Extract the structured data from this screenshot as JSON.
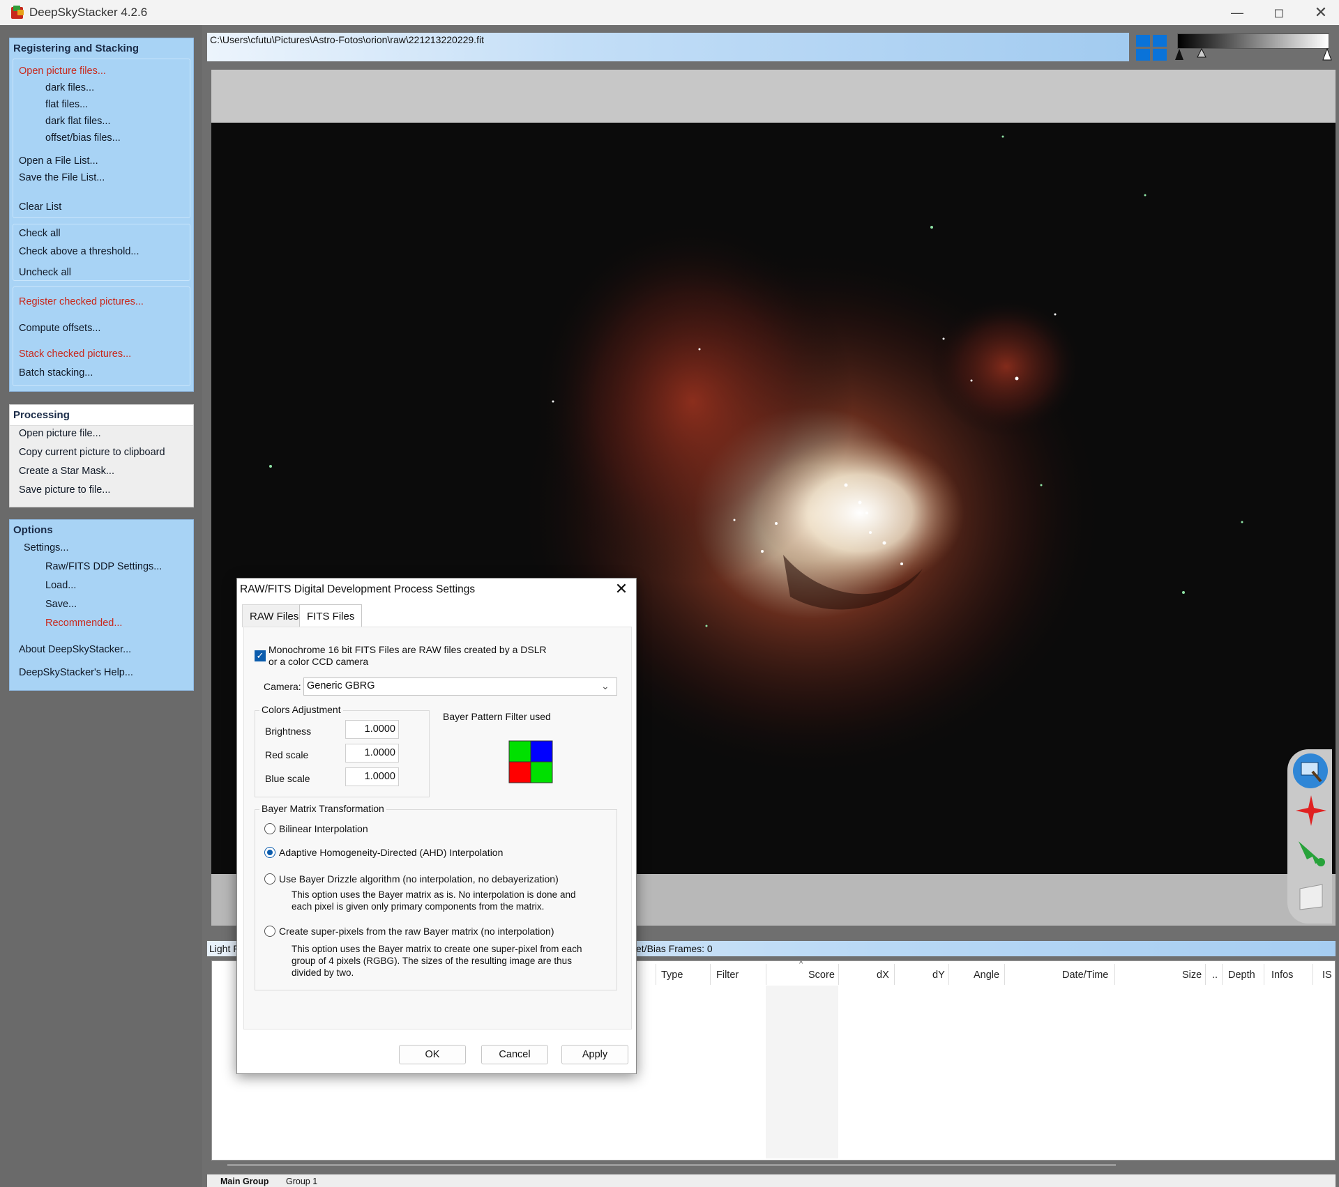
{
  "window": {
    "title": "DeepSkyStacker 4.2.6",
    "controls": [
      "minimize-icon",
      "maximize-icon",
      "close-icon"
    ]
  },
  "sidebar": {
    "registering": {
      "header": "Registering and Stacking",
      "open_picture_files": "Open picture files...",
      "dark_files": "dark files...",
      "flat_files": "flat files...",
      "dark_flat_files": "dark flat files...",
      "offset_bias_files": "offset/bias files...",
      "open_file_list": "Open a File List...",
      "save_file_list": "Save the File List...",
      "clear_list": "Clear List",
      "check_all": "Check all",
      "check_above_threshold": "Check above a threshold...",
      "uncheck_all": "Uncheck all",
      "register_checked": "Register checked pictures...",
      "compute_offsets": "Compute offsets...",
      "stack_checked": "Stack checked pictures...",
      "batch_stacking": "Batch stacking..."
    },
    "processing": {
      "header": "Processing",
      "open_picture_file": "Open picture file...",
      "copy_to_clipboard": "Copy current picture to clipboard",
      "create_star_mask": "Create a Star Mask...",
      "save_picture": "Save picture to file..."
    },
    "options": {
      "header": "Options",
      "settings": "Settings...",
      "raw_fits_ddp": "Raw/FITS DDP Settings...",
      "load": "Load...",
      "save": "Save...",
      "recommended": "Recommended...",
      "about": "About DeepSkyStacker...",
      "help": "DeepSkyStacker's Help..."
    }
  },
  "viewer": {
    "file_path": "C:\\Users\\cfutu\\Pictures\\Astro-Fotos\\orion\\raw\\221213220229.fit",
    "tools": [
      "select-rectangle-icon",
      "star-edit-icon",
      "comet-icon",
      "save-icon"
    ]
  },
  "frames": {
    "light_label": "Light F",
    "offset_count": "et/Bias Frames: 0",
    "columns": [
      "Type",
      "Filter",
      "Score",
      "dX",
      "dY",
      "Angle",
      "Date/Time",
      "Size",
      "..",
      "Depth",
      "Infos",
      "IS"
    ],
    "group_tabs": [
      "Main Group",
      "Group 1"
    ]
  },
  "dialog": {
    "title": "RAW/FITS Digital Development Process Settings",
    "tabs": [
      "RAW Files",
      "FITS Files"
    ],
    "active_tab": "FITS Files",
    "monochrome_line1": "Monochrome 16 bit FITS Files are RAW files created by a DSLR",
    "monochrome_line2": "or a color CCD camera",
    "monochrome_checked": true,
    "camera_label": "Camera:",
    "camera_value": "Generic GBRG",
    "colors_group": "Colors Adjustment",
    "brightness_label": "Brightness",
    "brightness_value": "1.0000",
    "red_label": "Red scale",
    "red_value": "1.0000",
    "blue_label": "Blue scale",
    "blue_value": "1.0000",
    "bayer_label": "Bayer Pattern Filter used",
    "bayer_colors": [
      "#00e000",
      "#0000ff",
      "#ff0000",
      "#00e000"
    ],
    "bayer_group": "Bayer Matrix Transformation",
    "bilinear": "Bilinear Interpolation",
    "ahd": "Adaptive Homogeneity-Directed (AHD) Interpolation",
    "drizzle": "Use Bayer Drizzle algorithm (no interpolation, no debayerization)",
    "drizzle_desc1": "This option uses the Bayer matrix as is. No interpolation is done and",
    "drizzle_desc2": "each pixel is given only primary components from the matrix.",
    "superpixel": "Create super-pixels from the raw Bayer matrix (no interpolation)",
    "superpixel_desc1": "This option uses the Bayer matrix to create one super-pixel from each",
    "superpixel_desc2": "group of 4 pixels (RGBG). The sizes of the resulting image are thus",
    "superpixel_desc3": "divided by two.",
    "selected_option": "ahd",
    "ok": "OK",
    "cancel": "Cancel",
    "apply": "Apply"
  }
}
